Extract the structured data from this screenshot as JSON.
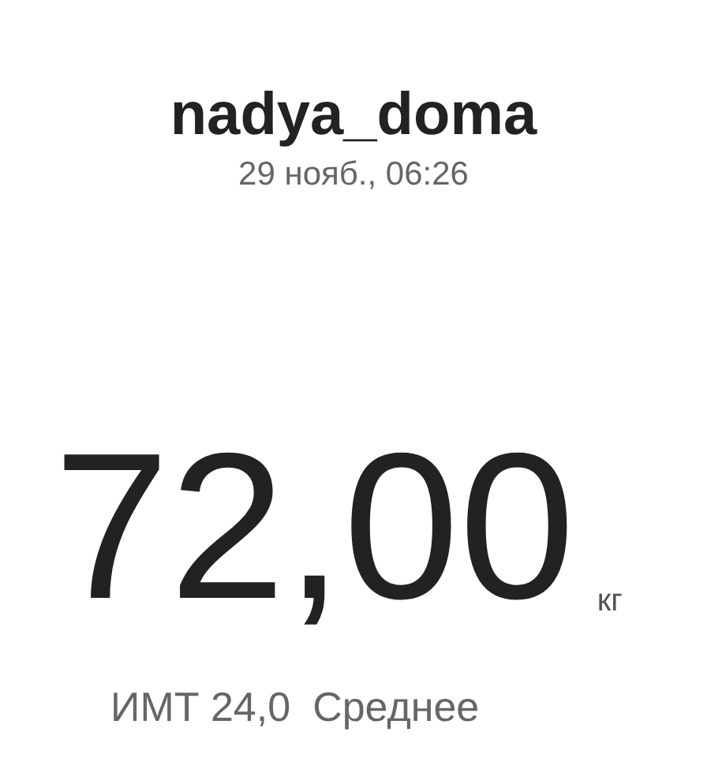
{
  "header": {
    "username": "nadya_doma",
    "date": "29 нояб., 06:26"
  },
  "weight": {
    "value": "72,00",
    "unit": "кг"
  },
  "bmi": {
    "label": "ИМТ 24,0",
    "category": "Среднее"
  }
}
